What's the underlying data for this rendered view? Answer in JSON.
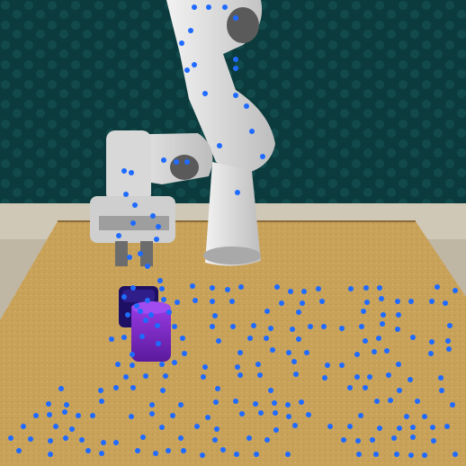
{
  "scene": {
    "colors": {
      "wall": "#0b3b3d",
      "wall_texture": "#155052",
      "floor": "#cfc8b6",
      "table": "#c9a25a",
      "table_edge": "#8a6a36",
      "robot_body": "#e4e4e4",
      "robot_shadow": "#9a9a9a",
      "robot_joint": "#5a5a5a",
      "cube_dark": "#1d0f63",
      "cube_purple": "#7a24c6",
      "tracking_point": "#1f6bff"
    },
    "objects": [
      {
        "name": "robot-arm",
        "kind": "manipulator"
      },
      {
        "name": "navy-block",
        "kind": "object"
      },
      {
        "name": "purple-block",
        "kind": "object"
      }
    ],
    "tracking_points_visible": true
  }
}
